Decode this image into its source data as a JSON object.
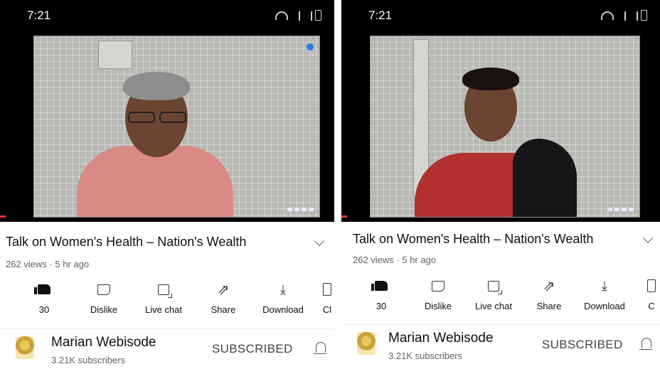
{
  "panels": [
    {
      "status_time": "7:21",
      "title": "Talk on Women's Health – Nation's Wealth",
      "meta": "262 views · 5 hr ago",
      "actions": [
        {
          "icon": "like-icon",
          "label": "30"
        },
        {
          "icon": "dislike-icon",
          "label": "Dislike"
        },
        {
          "icon": "live-chat-icon",
          "label": "Live chat"
        },
        {
          "icon": "share-icon",
          "label": "Share"
        },
        {
          "icon": "download-icon",
          "label": "Download"
        },
        {
          "icon": "clip-icon",
          "label": "Cl"
        }
      ],
      "channel": {
        "name": "Marian Webisode",
        "subscribers": "3.21K subscribers",
        "subscribe_label": "SUBSCRIBED"
      }
    },
    {
      "status_time": "7:21",
      "title": "Talk on Women's Health – Nation's Wealth",
      "meta": "262 views · 5 hr ago",
      "actions": [
        {
          "icon": "like-icon",
          "label": "30"
        },
        {
          "icon": "dislike-icon",
          "label": "Dislike"
        },
        {
          "icon": "live-chat-icon",
          "label": "Live chat"
        },
        {
          "icon": "share-icon",
          "label": "Share"
        },
        {
          "icon": "download-icon",
          "label": "Download"
        },
        {
          "icon": "clip-icon",
          "label": "C"
        }
      ],
      "channel": {
        "name": "Marian Webisode",
        "subscribers": "3.21K subscribers",
        "subscribe_label": "SUBSCRIBED"
      }
    }
  ],
  "glyphs": {
    "share": "⇗",
    "download": "⤓"
  },
  "colors": {
    "status_bar": "#000000",
    "progress": "#e53935",
    "text": "#0f0f0f",
    "secondary_text": "#606060"
  }
}
